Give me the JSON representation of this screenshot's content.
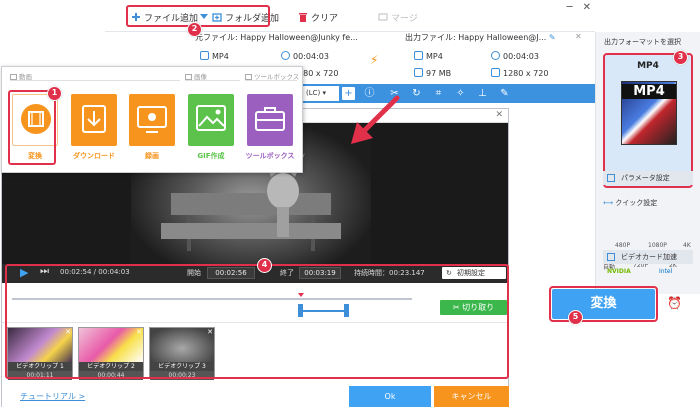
{
  "toolbar": {
    "add_file": "ファイル追加",
    "add_folder": "フォルダ追加",
    "clear": "クリア",
    "merge": "マージ"
  },
  "file_info": {
    "source_label": "元ファイル: Happy Halloween@Junky fe...",
    "source_format": "MP4",
    "source_duration": "00:04:03",
    "source_resolution": "1280 x 720",
    "output_label": "出力ファイル: Happy Halloween@J...",
    "output_format": "MP4",
    "output_duration": "00:04:03",
    "output_size": "97 MB",
    "output_resolution": "1280 x 720",
    "subtitle_label": "(LC)"
  },
  "right_panel": {
    "title": "出力フォーマットを選択",
    "format_name": "MP4",
    "format_art_text": "MP4",
    "params_button": "パラメータ設定",
    "quick_label": "クイック設定",
    "quality_marks_top": [
      "480P",
      "1080P",
      "4K"
    ],
    "quality_marks_bottom": [
      "自動",
      "720P",
      "2K"
    ],
    "gpu_label": "ビデオカード加速",
    "gpu_vendors": [
      "NVIDIA",
      "Intel"
    ]
  },
  "convert_button": "変換",
  "menu": {
    "section_video": "動画",
    "section_image": "画像",
    "section_toolbox": "ツールボックス",
    "items": [
      {
        "label": "変換",
        "color": "#f7941d"
      },
      {
        "label": "ダウンロード",
        "color": "#f7941d"
      },
      {
        "label": "録画",
        "color": "#f7941d"
      },
      {
        "label": "GIF作成",
        "color": "#5cc24b"
      },
      {
        "label": "ツールボックス",
        "color": "#9b5fc0"
      }
    ]
  },
  "editor": {
    "current_time": "00:02:54",
    "total_time": "00:04:03",
    "start_label": "開始",
    "start_value": "00:02:56",
    "end_label": "終了",
    "end_value": "00:03:19",
    "duration_label": "持続時間：",
    "duration_value": "00:23.147",
    "reset_button": "初期設定",
    "cut_button": "切り取り",
    "clips": [
      {
        "name": "ビデオクリップ 1",
        "time": "00:01:11"
      },
      {
        "name": "ビデオクリップ 2",
        "time": "00:00:44"
      },
      {
        "name": "ビデオクリップ 3",
        "time": "00:00:23"
      }
    ],
    "tutorial_link": "チュートリアル >",
    "ok_button": "Ok",
    "cancel_button": "キャンセル"
  },
  "badges": [
    "1",
    "2",
    "3",
    "4",
    "5"
  ],
  "colors": {
    "accent_blue": "#3c8fd8",
    "highlight_red": "#e0304a",
    "cut_green": "#3bb74c",
    "cancel_orange": "#f7941d"
  }
}
